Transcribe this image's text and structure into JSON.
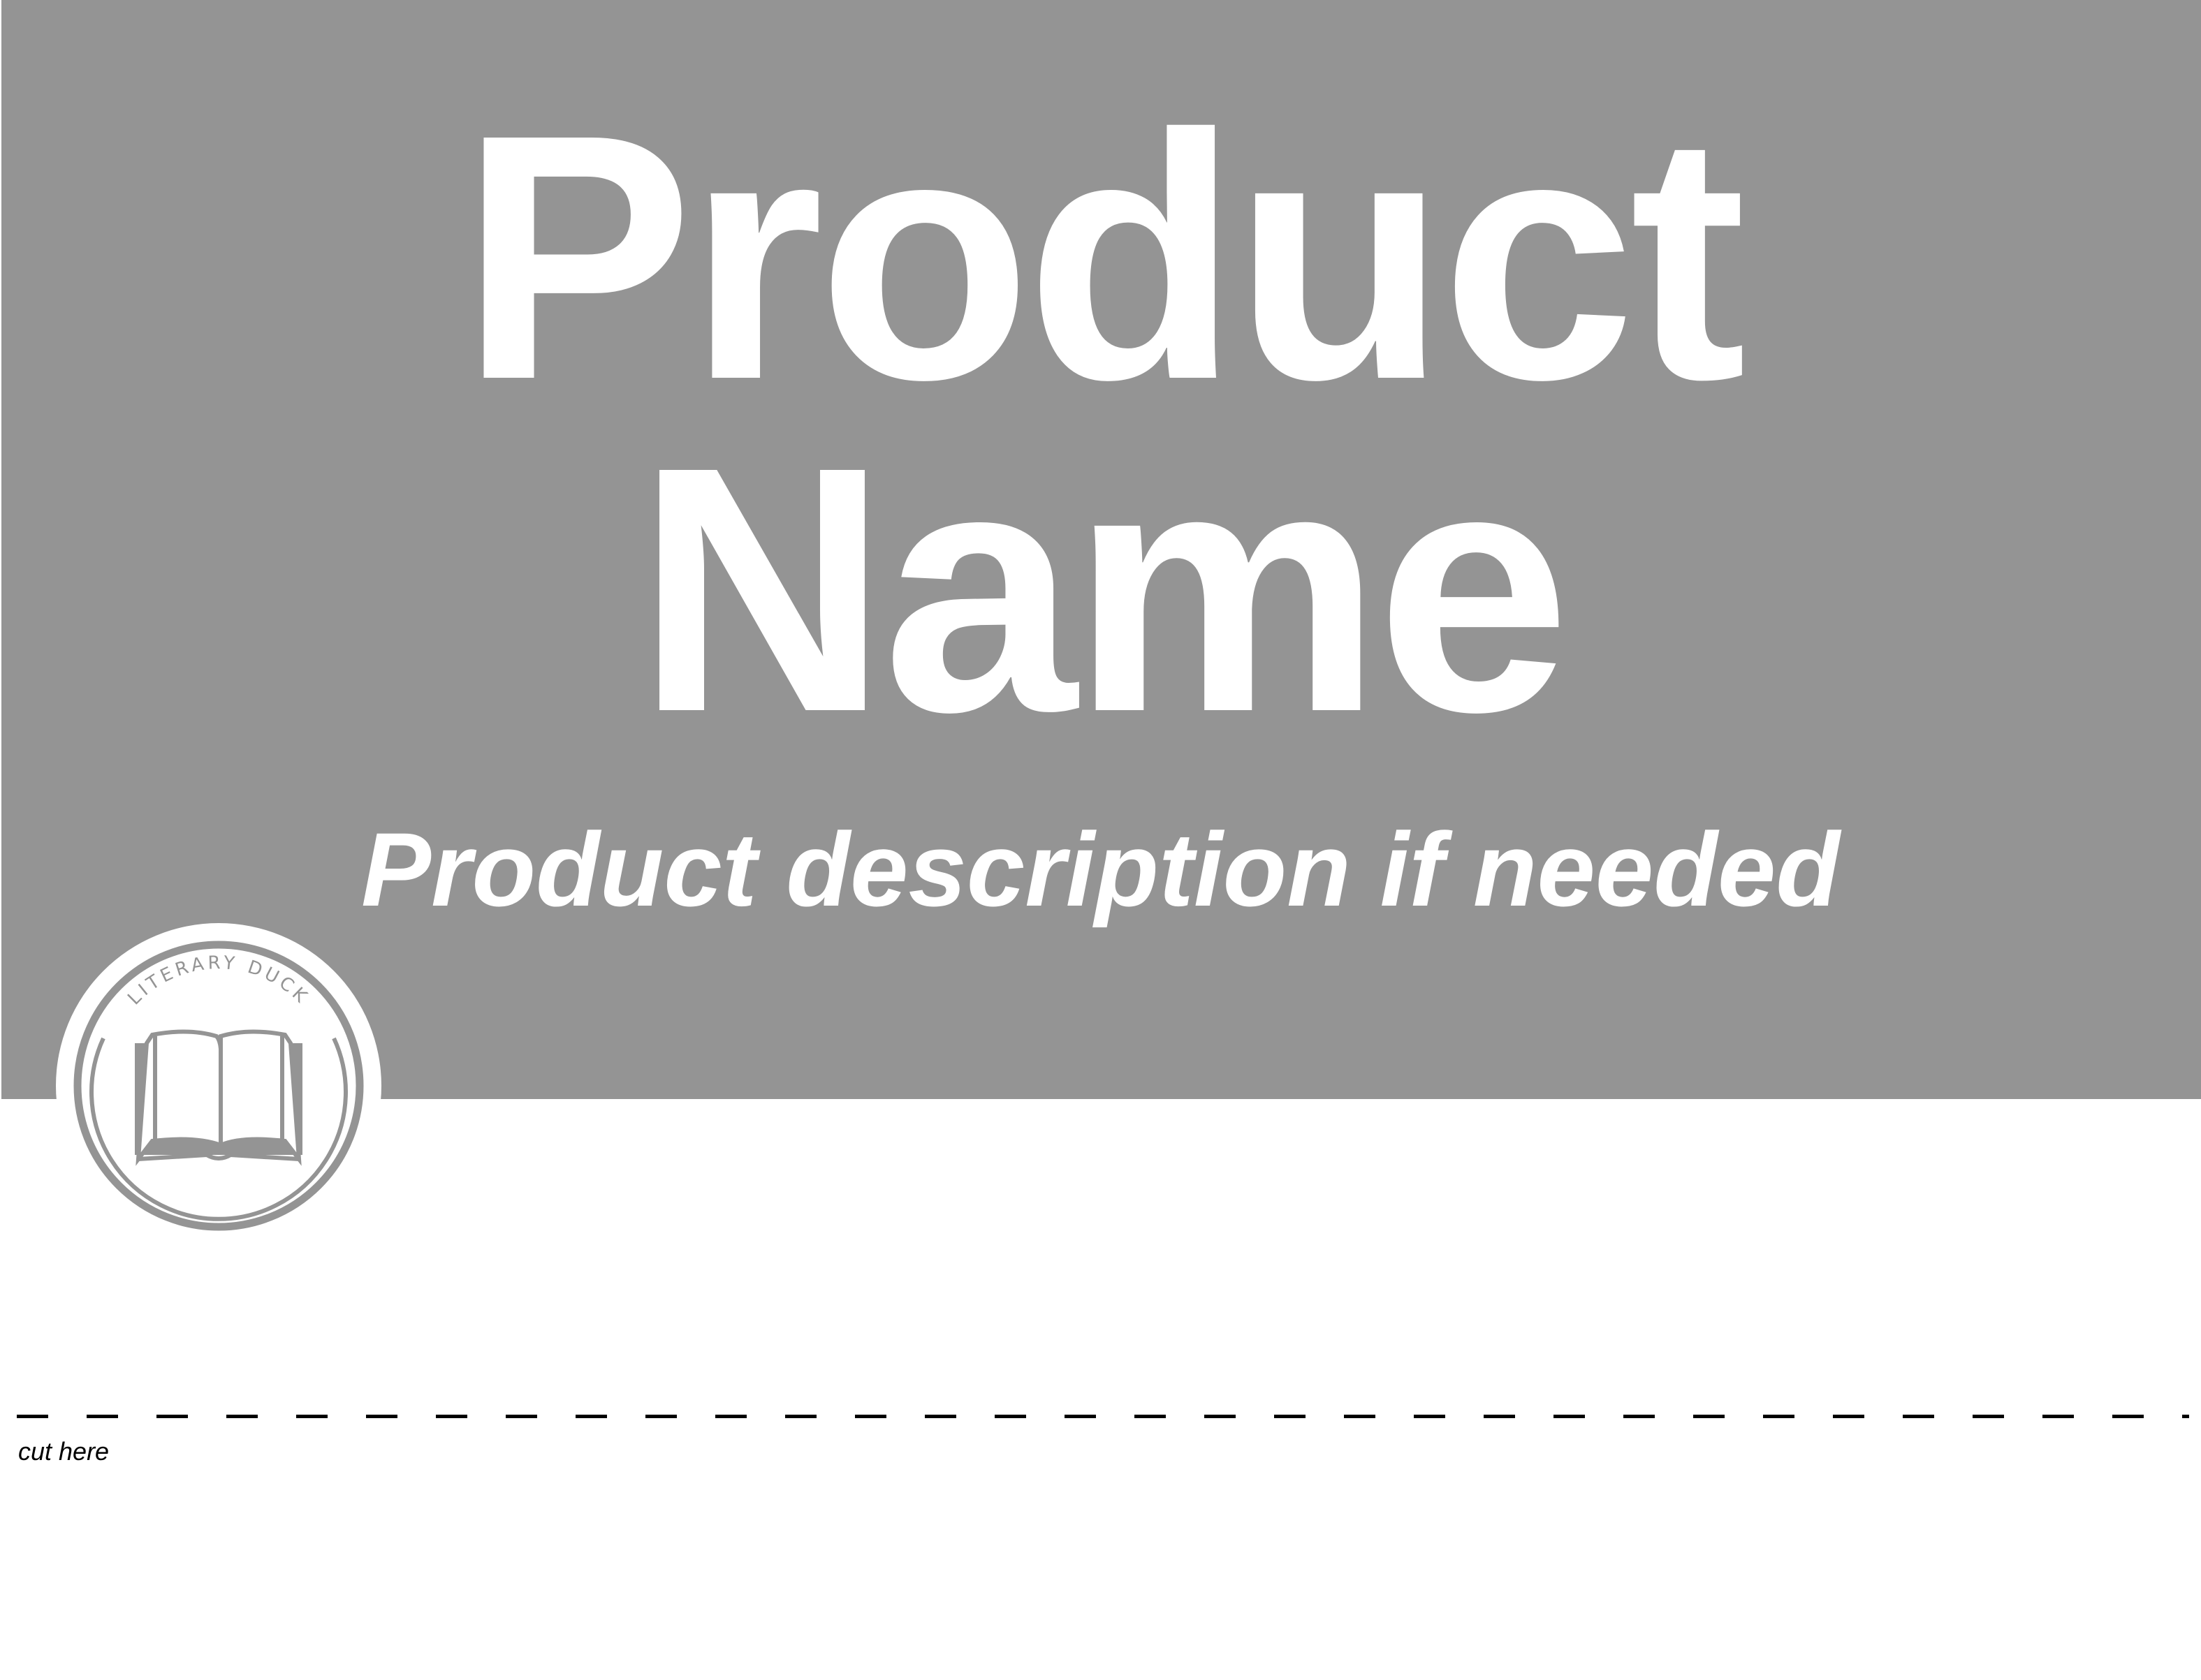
{
  "sign": {
    "title_line1": "Product",
    "title_line2": "Name",
    "description": "Product description if needed"
  },
  "logo": {
    "text": "LITERARY DUCK",
    "icon": "open-book-icon"
  },
  "cut": {
    "label": "cut here"
  },
  "colors": {
    "band": "#949494",
    "text": "#ffffff"
  }
}
